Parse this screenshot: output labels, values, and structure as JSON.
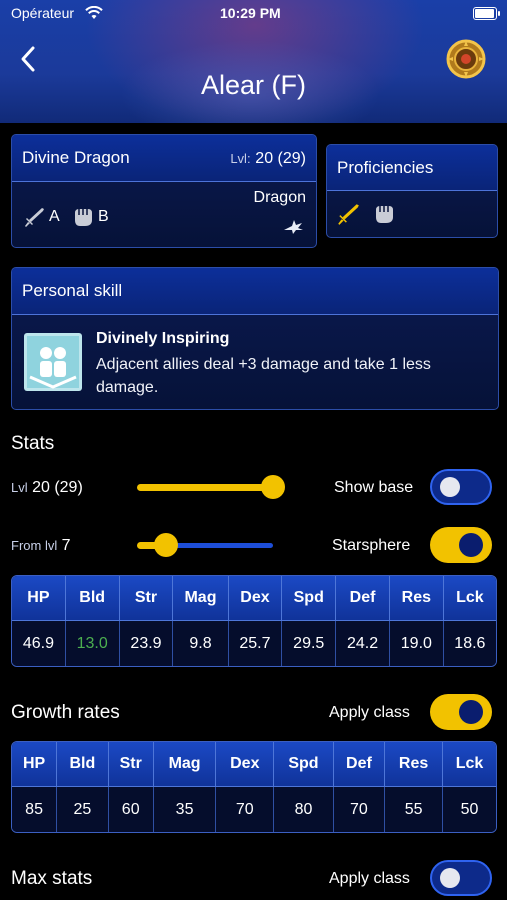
{
  "status_bar": {
    "carrier": "Opérateur",
    "time": "10:29 PM"
  },
  "header": {
    "title": "Alear (F)"
  },
  "class_card": {
    "name": "Divine Dragon",
    "lvl_label": "Lvl:",
    "lvl_value": "20 (29)",
    "weapons": [
      {
        "icon": "sword-icon",
        "rank": "A"
      },
      {
        "icon": "fist-icon",
        "rank": "B"
      }
    ],
    "type": "Dragon"
  },
  "proficiencies": {
    "title": "Proficiencies"
  },
  "personal_skill": {
    "title": "Personal skill",
    "name": "Divinely Inspiring",
    "description": "Adjacent allies deal +3 damage and take 1 less damage."
  },
  "stats": {
    "title": "Stats",
    "lvl_label": "Lvl",
    "lvl_value": "20 (29)",
    "lvl_slider_fraction": 1.0,
    "show_base_label": "Show base",
    "show_base_on": false,
    "from_lvl_label": "From lvl",
    "from_lvl_value": "7",
    "from_lvl_fraction": 0.2,
    "starsphere_label": "Starsphere",
    "starsphere_on": true,
    "headers": [
      "HP",
      "Bld",
      "Str",
      "Mag",
      "Dex",
      "Spd",
      "Def",
      "Res",
      "Lck"
    ],
    "values": [
      "46.9",
      "13.0",
      "23.9",
      "9.8",
      "25.7",
      "29.5",
      "24.2",
      "19.0",
      "18.6"
    ],
    "highlight_color": "#4caf50"
  },
  "growth_rates": {
    "title": "Growth rates",
    "apply_class_label": "Apply class",
    "apply_class_on": true,
    "headers": [
      "HP",
      "Bld",
      "Str",
      "Mag",
      "Dex",
      "Spd",
      "Def",
      "Res",
      "Lck"
    ],
    "values": [
      "85",
      "25",
      "60",
      "35",
      "70",
      "80",
      "70",
      "55",
      "50"
    ]
  },
  "max_stats": {
    "title": "Max stats",
    "apply_class_label": "Apply class",
    "apply_class_on": false
  },
  "colors": {
    "accent_yellow": "#f2c200",
    "panel_blue": "#0c2f9a"
  }
}
